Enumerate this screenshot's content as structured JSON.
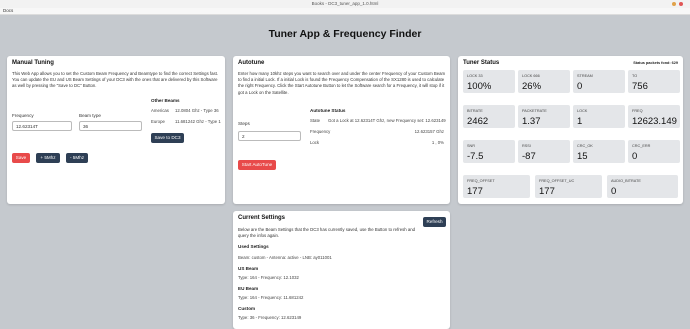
{
  "window": {
    "title": "Books - DC3_tuner_app_1.0.html",
    "menu": "Docs"
  },
  "app_title": "Tuner App & Frequency Finder",
  "manual": {
    "title": "Manual Tuning",
    "desc": "This Web App allows you to set the Custom Beam Frequency and Beamtype to find the correct Settings fast. You can update the EU and US Beam Settings of your DC3 with the ones that are delivered by this Software as well by pressing the \"Save to DC\" Button.",
    "frequency_label": "Frequency",
    "frequency_value": "12.62314T",
    "beam_label": "Beam type",
    "beam_value": "36",
    "other_beams_title": "Other Beams",
    "americas_label": "Americas",
    "americas_value": "12.0804 Ghz - Type 36",
    "europe_label": "Europe",
    "europe_value": "11.681242 Ghz - Type 164",
    "save_dc3": "Save to DC3",
    "save": "Save",
    "plus_mhz": "+ 5Mhz",
    "minus_mhz": "- 5Mhz"
  },
  "autotune": {
    "title": "Autotune",
    "desc": "Enter how many 10khz steps you want to search over and under the center Frequency of your Custom Beam to find a initial Lock. If a initial Lock is found the Frequency Compensation of the SX1280 is used to calculate the right Frequency. Click the Start Autotune Button to let the Software search for a Frequency, it will stop if it got a Lock on the Satellite.",
    "steps_label": "Steps",
    "steps_value": "2",
    "status_title": "Autotune Status",
    "state_label": "State",
    "state_value": "Got a Lock at 12.62314T Ghz, new Frequency set: 12.623149",
    "frequency_label": "Frequency",
    "frequency_value": "12.623157 Ghz",
    "lock_label": "Lock",
    "lock_value": "1 , 0%",
    "start": "Start AutoTune"
  },
  "status": {
    "title": "Tuner Status",
    "packets": "Status packets fond: 629",
    "tiles": [
      {
        "label": "LOCK 33",
        "value": "100%"
      },
      {
        "label": "LOCK 666",
        "value": "26%"
      },
      {
        "label": "STREAM",
        "value": "0"
      },
      {
        "label": "TO",
        "value": "756"
      },
      {
        "label": "BITRATE",
        "value": "2462"
      },
      {
        "label": "PACKETRATE",
        "value": "1.37"
      },
      {
        "label": "LOCK",
        "value": "1"
      },
      {
        "label": "FREQ",
        "value": "12623.149"
      },
      {
        "label": "SNR",
        "value": "-7.5"
      },
      {
        "label": "RSSI",
        "value": "-87"
      },
      {
        "label": "CRC_OK",
        "value": "15"
      },
      {
        "label": "CRC_ERR",
        "value": "0"
      },
      {
        "label": "FREQ_OFFSET",
        "value": "177"
      },
      {
        "label": "FREQ_OFFSET_UC",
        "value": "177"
      },
      {
        "label": "AUDIO_BITRATE",
        "value": "0"
      }
    ]
  },
  "current": {
    "title": "Current Settings",
    "refresh": "Refresh",
    "desc": "Below are the Beam Settings that the DC3 has currently saved, use the Button to refresh and query the infos again.",
    "used_title": "Used Settings",
    "used_value": "Beam: custom - Antenna: active - LNB: ay011001",
    "us_title": "US Beam",
    "us_value": "Type: 164 - Frequency: 12.1032",
    "eu_title": "EU Beam",
    "eu_value": "Type: 164 - Frequency: 11.681242",
    "custom_title": "Custom",
    "custom_value": "Type: 36 - Frequency: 12.623149"
  }
}
